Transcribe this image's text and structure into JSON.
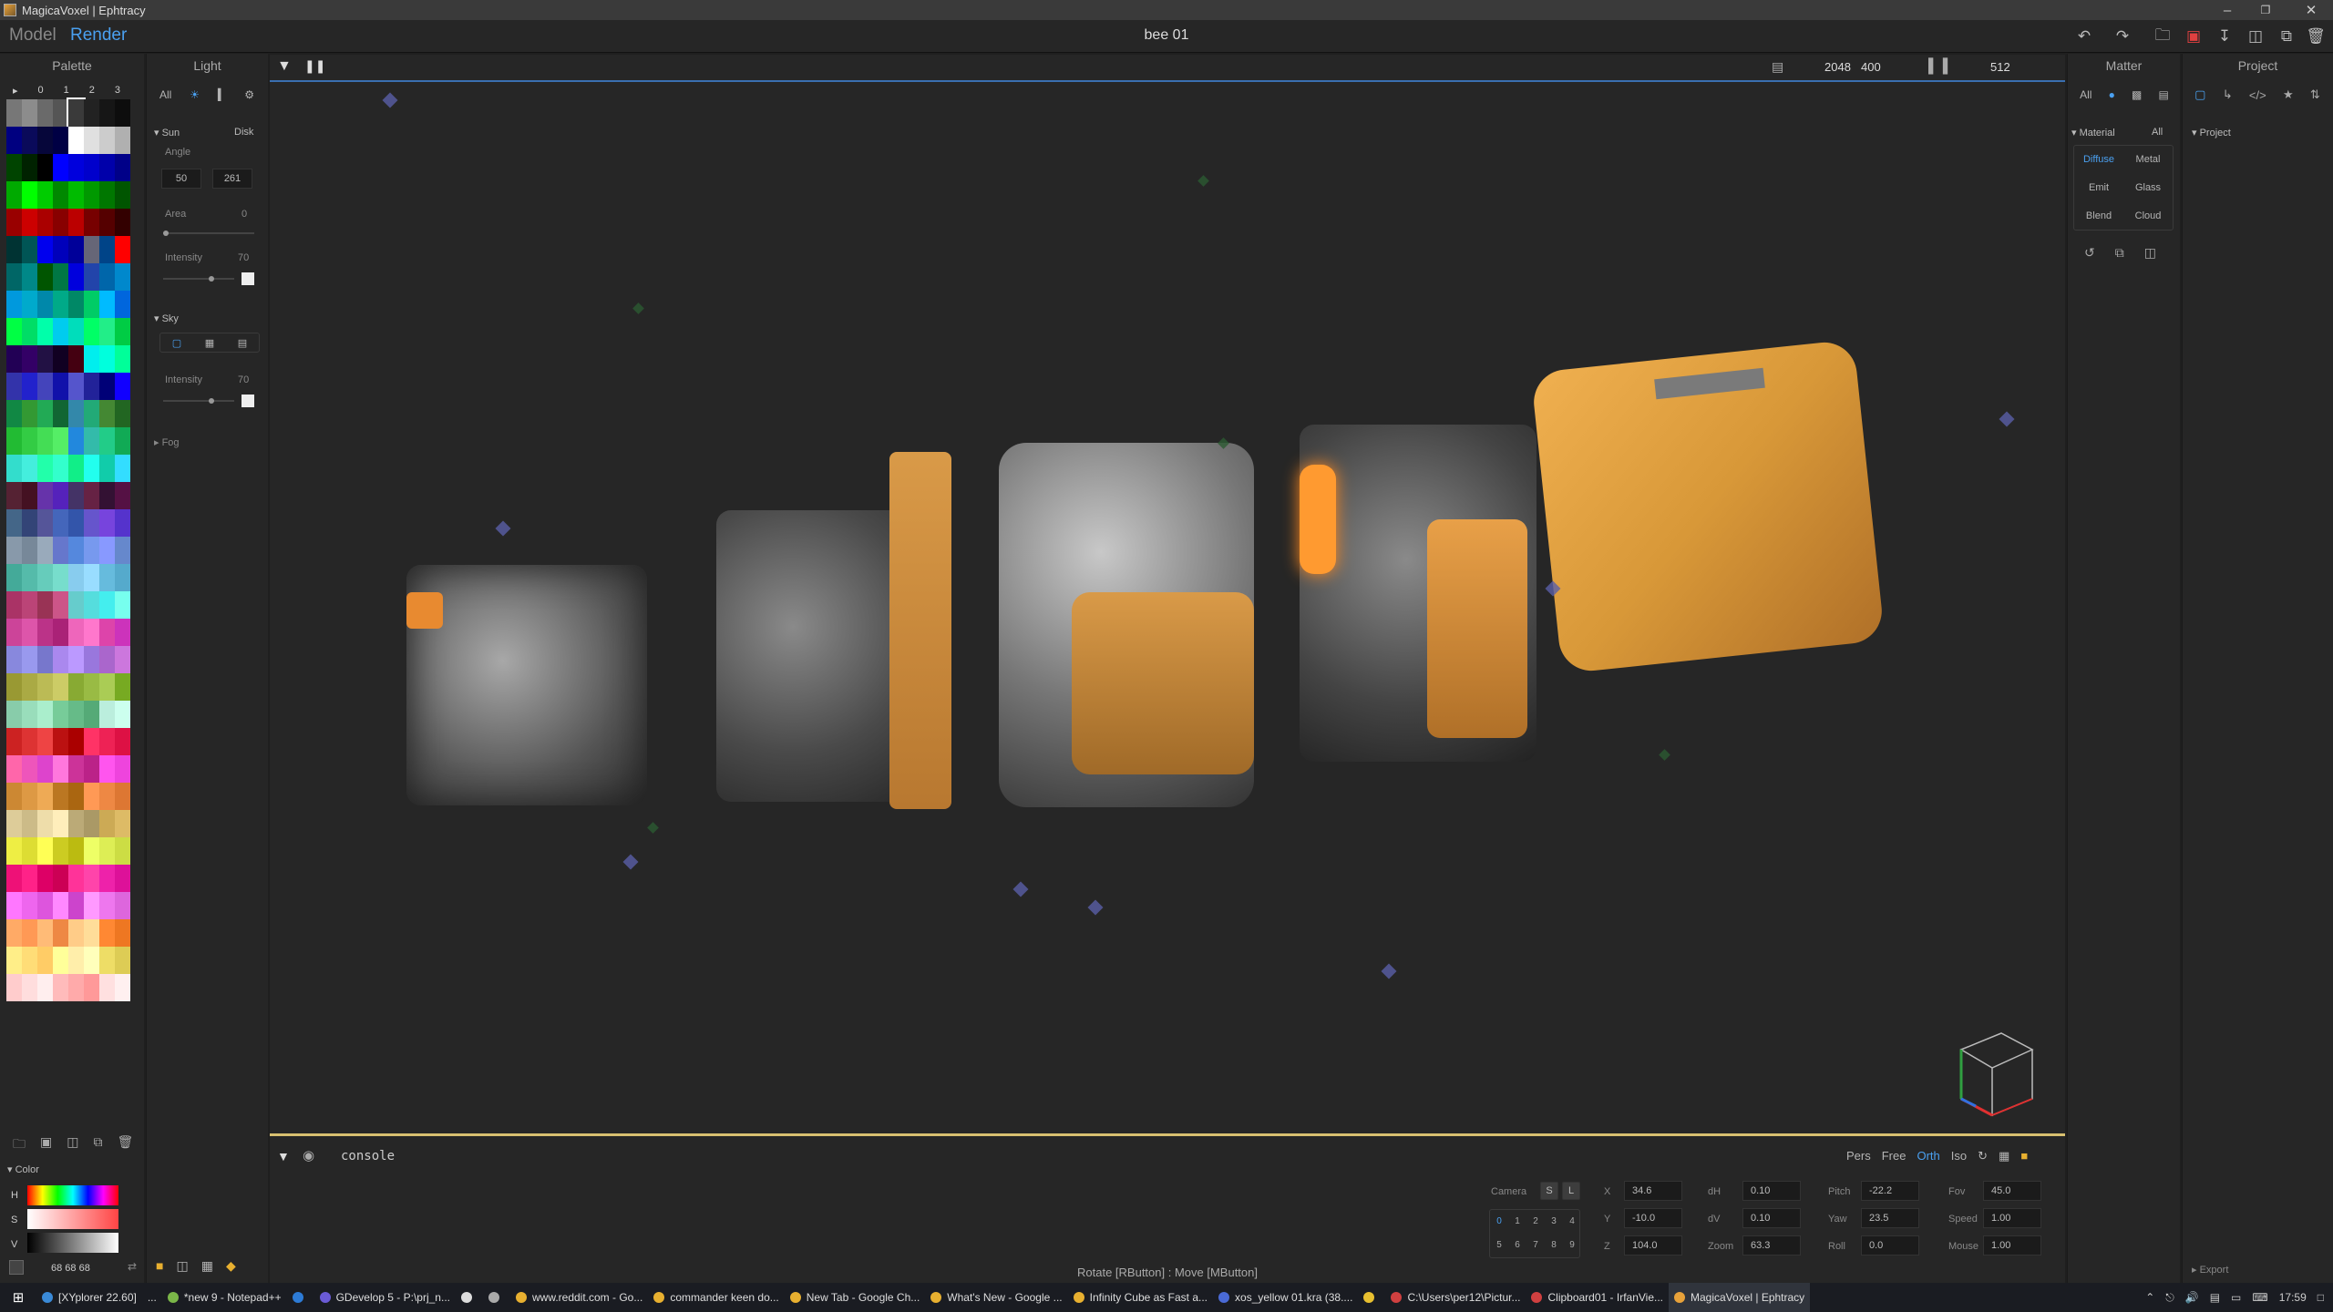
{
  "window": {
    "title": "MagicaVoxel | Ephtracy"
  },
  "menubar": {
    "model": "Model",
    "render": "Render",
    "document": "bee 01"
  },
  "left": {
    "palette_title": "Palette",
    "palette_tabs": [
      "▸",
      "0",
      "1",
      "2",
      "3"
    ],
    "palette_colors": [
      "#777777",
      "#8c8c8c",
      "#6a6a6a",
      "#555555",
      "#3a3a3a",
      "#222222",
      "#161616",
      "#0d0d0d",
      "#000080",
      "#0a0a5a",
      "#06063a",
      "#000044",
      "#ffffff",
      "#e0e0e0",
      "#cccccc",
      "#b0b0b0",
      "#004400",
      "#002200",
      "#000000",
      "#0000ff",
      "#0000dd",
      "#0000cc",
      "#0000aa",
      "#000088",
      "#00aa00",
      "#00ff00",
      "#00cc00",
      "#008800",
      "#00bb00",
      "#009900",
      "#007700",
      "#005500",
      "#990000",
      "#cc0000",
      "#aa0000",
      "#880000",
      "#bb0000",
      "#770000",
      "#550000",
      "#330000",
      "#003333",
      "#005555",
      "#0000ee",
      "#0000bb",
      "#000099",
      "#666677",
      "#004488",
      "#ff0000",
      "#006666",
      "#008888",
      "#005500",
      "#007744",
      "#0000dd",
      "#2244aa",
      "#0066aa",
      "#0088cc",
      "#0099dd",
      "#00aacc",
      "#0088aa",
      "#00aa88",
      "#008866",
      "#00cc66",
      "#00bbff",
      "#0066dd",
      "#00ff44",
      "#00dd66",
      "#00ffaa",
      "#00ccee",
      "#00ddbb",
      "#00ff66",
      "#22ee88",
      "#00cc44",
      "#220055",
      "#330066",
      "#221144",
      "#110022",
      "#440011",
      "#00eeee",
      "#00ffdd",
      "#00ff99",
      "#3333aa",
      "#2222cc",
      "#4444bb",
      "#1111aa",
      "#5555cc",
      "#222299",
      "#000077",
      "#1100ff",
      "#118844",
      "#339933",
      "#22aa55",
      "#116633",
      "#3388aa",
      "#22aa77",
      "#448833",
      "#226622",
      "#22bb33",
      "#33cc44",
      "#44dd55",
      "#55ee66",
      "#2288dd",
      "#33bbaa",
      "#22cc88",
      "#11aa55",
      "#33ddcc",
      "#44eedd",
      "#22ffaa",
      "#33ffcc",
      "#11ee88",
      "#22ffee",
      "#11ccaa",
      "#33ddff",
      "#552233",
      "#441122",
      "#6633aa",
      "#5522bb",
      "#443366",
      "#662244",
      "#331133",
      "#551144",
      "#446688",
      "#334477",
      "#555599",
      "#4466bb",
      "#3355aa",
      "#6655cc",
      "#7744dd",
      "#5533cc",
      "#8899aa",
      "#778899",
      "#99aabb",
      "#6677cc",
      "#5588dd",
      "#7799ee",
      "#8899ff",
      "#6688cc",
      "#44aa99",
      "#55bbaa",
      "#66ccbb",
      "#77ddcc",
      "#88ccee",
      "#99ddff",
      "#66bbdd",
      "#55aacc",
      "#aa3366",
      "#bb4477",
      "#993355",
      "#cc5588",
      "#66cccc",
      "#55dddd",
      "#44eeee",
      "#77ffee",
      "#cc4499",
      "#dd55aa",
      "#bb3388",
      "#aa2277",
      "#ee66bb",
      "#ff77cc",
      "#dd44aa",
      "#cc33bb",
      "#8888dd",
      "#9999ee",
      "#7777cc",
      "#aa88ee",
      "#bb99ff",
      "#9977dd",
      "#aa66cc",
      "#cc77dd",
      "#999933",
      "#aaaa44",
      "#bbbb55",
      "#cccc66",
      "#88aa33",
      "#99bb44",
      "#aacc55",
      "#77aa22",
      "#88ccaa",
      "#99ddbb",
      "#aaeecc",
      "#77cc99",
      "#66bb88",
      "#55aa77",
      "#bbeedd",
      "#ccffee",
      "#cc2222",
      "#dd3333",
      "#ee4444",
      "#bb1111",
      "#aa0000",
      "#ff3366",
      "#ee2255",
      "#dd1144",
      "#ff66aa",
      "#ee55bb",
      "#dd44cc",
      "#ff77dd",
      "#cc3399",
      "#bb2288",
      "#ff55ee",
      "#ee44dd",
      "#cc8833",
      "#dd9944",
      "#eeaa55",
      "#bb7722",
      "#aa6611",
      "#ff9955",
      "#ee8844",
      "#dd7733",
      "#ddcc99",
      "#ccbb88",
      "#eeddaa",
      "#ffeebb",
      "#bbaa77",
      "#aa9966",
      "#ccaa55",
      "#ddbb66",
      "#eeee44",
      "#dddd33",
      "#ffff55",
      "#cccc22",
      "#bbbb11",
      "#eeff66",
      "#ddee55",
      "#ccdd44",
      "#ee1177",
      "#ff2288",
      "#dd0066",
      "#cc0055",
      "#ff3399",
      "#ff44aa",
      "#ee22aa",
      "#dd1199",
      "#ff77ff",
      "#ee66ee",
      "#dd55dd",
      "#ff88ff",
      "#cc44cc",
      "#ff99ff",
      "#ee77ee",
      "#dd66dd",
      "#ffaa66",
      "#ff9955",
      "#ffbb77",
      "#ee8844",
      "#ffcc88",
      "#ffdd99",
      "#ff8833",
      "#ee7722",
      "#ffee88",
      "#ffdd77",
      "#ffcc66",
      "#ffff99",
      "#ffeeaa",
      "#ffffbb",
      "#eedd66",
      "#ddcc55",
      "#ffcccc",
      "#ffdddd",
      "#ffeeee",
      "#ffbbbb",
      "#ffaaaa",
      "#ff9999",
      "#ffe0e0",
      "#fff0f0"
    ],
    "color_title": "Color",
    "color_rows": [
      "H",
      "S",
      "V"
    ],
    "color_value": "68  68  68",
    "light_title": "Light",
    "light_filter_all": "All",
    "sun": {
      "title": "Sun",
      "mode": "Disk",
      "angle_label": "Angle",
      "angle_a": "50",
      "angle_b": "261",
      "area_label": "Area",
      "area_value": "0",
      "intensity_label": "Intensity",
      "intensity_value": "70"
    },
    "sky": {
      "title": "Sky",
      "intensity_label": "Intensity",
      "intensity_value": "70"
    },
    "fog": {
      "title": "Fog"
    }
  },
  "viewport": {
    "resolution_w": "2048",
    "resolution_h": "400",
    "samples": "512"
  },
  "console": {
    "label": "console",
    "proj_modes": [
      "Pers",
      "Free",
      "Orth",
      "Iso"
    ],
    "proj_selected": "Orth",
    "camera_label": "Camera",
    "camera_btns": [
      "S",
      "L"
    ],
    "camera_slots": [
      "0",
      "1",
      "2",
      "3",
      "4",
      "5",
      "6",
      "7",
      "8",
      "9"
    ],
    "fields": {
      "x_label": "X",
      "x": "34.6",
      "y_label": "Y",
      "y": "-10.0",
      "z_label": "Z",
      "z": "104.0",
      "dh_label": "dH",
      "dh": "0.10",
      "dv_label": "dV",
      "dv": "0.10",
      "zoom_label": "Zoom",
      "zoom": "63.3",
      "pitch_label": "Pitch",
      "pitch": "-22.2",
      "yaw_label": "Yaw",
      "yaw": "23.5",
      "roll_label": "Roll",
      "roll": "0.0",
      "fov_label": "Fov",
      "fov": "45.0",
      "speed_label": "Speed",
      "speed": "1.00",
      "mouse_label": "Mouse",
      "mouse": "1.00"
    },
    "status": "Rotate [RButton] : Move [MButton]"
  },
  "right": {
    "matter_title": "Matter",
    "matter_filter_all": "All",
    "material_title": "Material",
    "material_all": "All",
    "materials": [
      "Diffuse",
      "Metal",
      "Emit",
      "Glass",
      "Blend",
      "Cloud"
    ],
    "material_selected": "Diffuse",
    "project_title": "Project",
    "project_section": "Project",
    "export_label": "Export"
  },
  "taskbar": {
    "items": [
      {
        "label": "[XYplorer 22.60]",
        "color": "#3a8ad8"
      },
      {
        "label": "...",
        "color": ""
      },
      {
        "label": "*new 9 - Notepad++",
        "color": "#7ab648"
      },
      {
        "label": "",
        "color": "#2d7bd6"
      },
      {
        "label": "GDevelop 5 - P:\\prj_n...",
        "color": "#6b5bd6"
      },
      {
        "label": "",
        "color": "#dddddd"
      },
      {
        "label": "",
        "color": "#aaaaaa"
      },
      {
        "label": "www.reddit.com - Go...",
        "color": "#e8b030"
      },
      {
        "label": "commander keen do...",
        "color": "#e8b030"
      },
      {
        "label": "New Tab - Google Ch...",
        "color": "#e8b030"
      },
      {
        "label": "What's New - Google ...",
        "color": "#e8b030"
      },
      {
        "label": "Infinity Cube as Fast a...",
        "color": "#e8b030"
      },
      {
        "label": "xos_yellow 01.kra (38....",
        "color": "#4a6ad6"
      },
      {
        "label": "",
        "color": "#e8c030"
      },
      {
        "label": "C:\\Users\\per12\\Pictur...",
        "color": "#d04040"
      },
      {
        "label": "Clipboard01 - IrfanVie...",
        "color": "#d04040"
      },
      {
        "label": "MagicaVoxel | Ephtracy",
        "color": "#e8a23a"
      }
    ],
    "clock": "17:59"
  },
  "colors": {
    "accent": "#3a8ad8",
    "orange": "#e0a040",
    "console_bar": "#d8c070"
  }
}
